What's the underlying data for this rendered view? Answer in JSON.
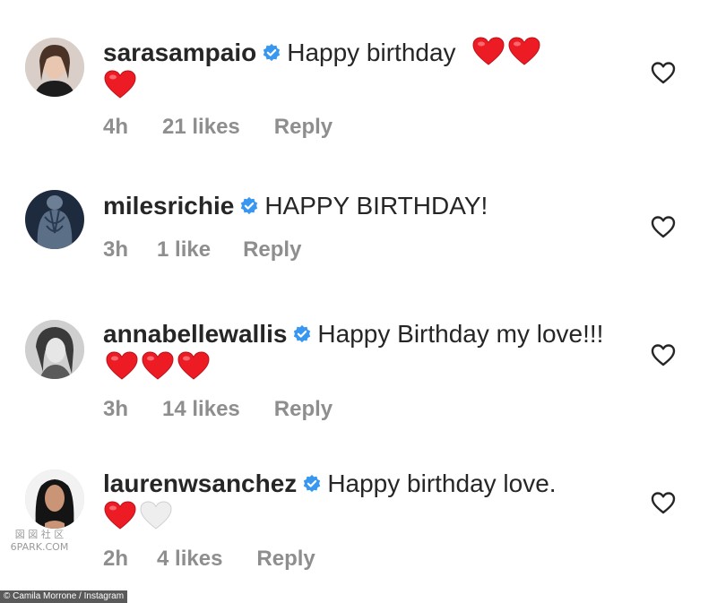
{
  "comments": [
    {
      "username": "sarasampaio",
      "text": "Happy birthday",
      "hearts": [
        "red",
        "red",
        "red"
      ],
      "time": "4h",
      "likes": "21 likes",
      "reply": "Reply",
      "avatar_icon": "profile-photo"
    },
    {
      "username": "milesrichie",
      "text": "HAPPY BIRTHDAY!",
      "hearts": [],
      "time": "3h",
      "likes": "1 like",
      "reply": "Reply",
      "avatar_icon": "profile-photo"
    },
    {
      "username": "annabellewallis",
      "text": "Happy Birthday my love!!!",
      "hearts": [
        "red",
        "red",
        "red"
      ],
      "time": "3h",
      "likes": "14 likes",
      "reply": "Reply",
      "avatar_icon": "profile-photo"
    },
    {
      "username": "laurenwsanchez",
      "text": "Happy birthday love.",
      "hearts": [
        "red",
        "white"
      ],
      "time": "2h",
      "likes": "4 likes",
      "reply": "Reply",
      "avatar_icon": "profile-photo"
    }
  ],
  "watermark": {
    "line1": "図 図 社 区",
    "line2": "6PARK.COM"
  },
  "credit": "© Camila Morrone / Instagram",
  "colors": {
    "text": "#262626",
    "meta": "#8e8e8e",
    "verified": "#3897f0",
    "heart_red": "#ed1c24",
    "heart_white": "#e6e6e6"
  },
  "icons": {
    "verified": "verified-badge-icon",
    "like": "heart-outline-icon",
    "emoji_heart": "red-heart-emoji"
  }
}
